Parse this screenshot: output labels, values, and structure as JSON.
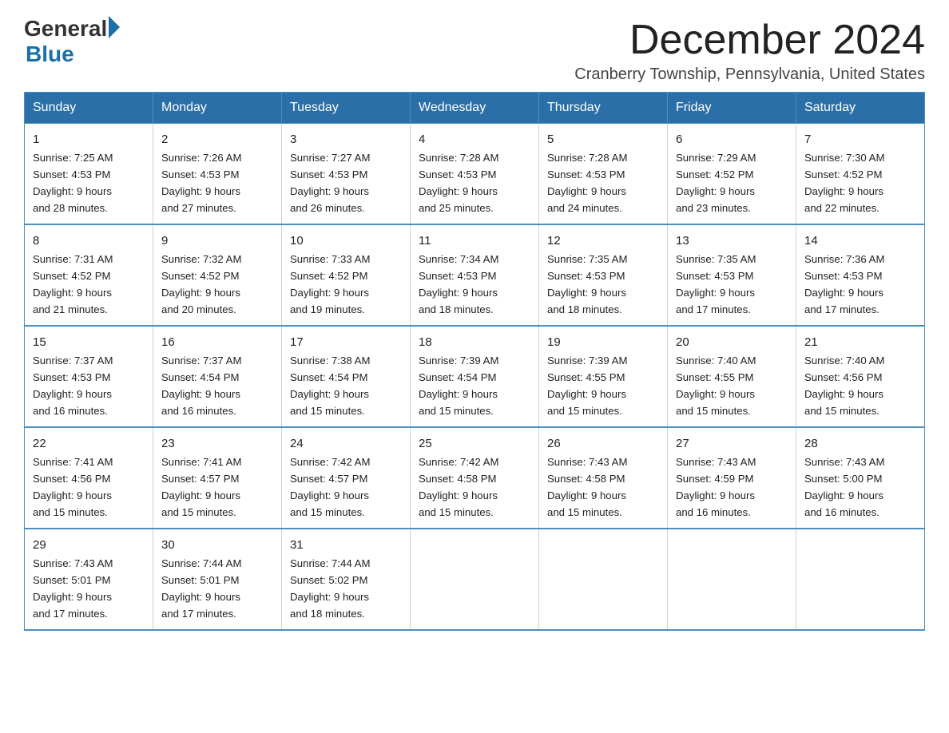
{
  "header": {
    "logo_general": "General",
    "logo_blue": "Blue",
    "month_title": "December 2024",
    "location": "Cranberry Township, Pennsylvania, United States"
  },
  "weekdays": [
    "Sunday",
    "Monday",
    "Tuesday",
    "Wednesday",
    "Thursday",
    "Friday",
    "Saturday"
  ],
  "weeks": [
    [
      {
        "day": "1",
        "sunrise": "7:25 AM",
        "sunset": "4:53 PM",
        "daylight": "9 hours and 28 minutes."
      },
      {
        "day": "2",
        "sunrise": "7:26 AM",
        "sunset": "4:53 PM",
        "daylight": "9 hours and 27 minutes."
      },
      {
        "day": "3",
        "sunrise": "7:27 AM",
        "sunset": "4:53 PM",
        "daylight": "9 hours and 26 minutes."
      },
      {
        "day": "4",
        "sunrise": "7:28 AM",
        "sunset": "4:53 PM",
        "daylight": "9 hours and 25 minutes."
      },
      {
        "day": "5",
        "sunrise": "7:28 AM",
        "sunset": "4:53 PM",
        "daylight": "9 hours and 24 minutes."
      },
      {
        "day": "6",
        "sunrise": "7:29 AM",
        "sunset": "4:52 PM",
        "daylight": "9 hours and 23 minutes."
      },
      {
        "day": "7",
        "sunrise": "7:30 AM",
        "sunset": "4:52 PM",
        "daylight": "9 hours and 22 minutes."
      }
    ],
    [
      {
        "day": "8",
        "sunrise": "7:31 AM",
        "sunset": "4:52 PM",
        "daylight": "9 hours and 21 minutes."
      },
      {
        "day": "9",
        "sunrise": "7:32 AM",
        "sunset": "4:52 PM",
        "daylight": "9 hours and 20 minutes."
      },
      {
        "day": "10",
        "sunrise": "7:33 AM",
        "sunset": "4:52 PM",
        "daylight": "9 hours and 19 minutes."
      },
      {
        "day": "11",
        "sunrise": "7:34 AM",
        "sunset": "4:53 PM",
        "daylight": "9 hours and 18 minutes."
      },
      {
        "day": "12",
        "sunrise": "7:35 AM",
        "sunset": "4:53 PM",
        "daylight": "9 hours and 18 minutes."
      },
      {
        "day": "13",
        "sunrise": "7:35 AM",
        "sunset": "4:53 PM",
        "daylight": "9 hours and 17 minutes."
      },
      {
        "day": "14",
        "sunrise": "7:36 AM",
        "sunset": "4:53 PM",
        "daylight": "9 hours and 17 minutes."
      }
    ],
    [
      {
        "day": "15",
        "sunrise": "7:37 AM",
        "sunset": "4:53 PM",
        "daylight": "9 hours and 16 minutes."
      },
      {
        "day": "16",
        "sunrise": "7:37 AM",
        "sunset": "4:54 PM",
        "daylight": "9 hours and 16 minutes."
      },
      {
        "day": "17",
        "sunrise": "7:38 AM",
        "sunset": "4:54 PM",
        "daylight": "9 hours and 15 minutes."
      },
      {
        "day": "18",
        "sunrise": "7:39 AM",
        "sunset": "4:54 PM",
        "daylight": "9 hours and 15 minutes."
      },
      {
        "day": "19",
        "sunrise": "7:39 AM",
        "sunset": "4:55 PM",
        "daylight": "9 hours and 15 minutes."
      },
      {
        "day": "20",
        "sunrise": "7:40 AM",
        "sunset": "4:55 PM",
        "daylight": "9 hours and 15 minutes."
      },
      {
        "day": "21",
        "sunrise": "7:40 AM",
        "sunset": "4:56 PM",
        "daylight": "9 hours and 15 minutes."
      }
    ],
    [
      {
        "day": "22",
        "sunrise": "7:41 AM",
        "sunset": "4:56 PM",
        "daylight": "9 hours and 15 minutes."
      },
      {
        "day": "23",
        "sunrise": "7:41 AM",
        "sunset": "4:57 PM",
        "daylight": "9 hours and 15 minutes."
      },
      {
        "day": "24",
        "sunrise": "7:42 AM",
        "sunset": "4:57 PM",
        "daylight": "9 hours and 15 minutes."
      },
      {
        "day": "25",
        "sunrise": "7:42 AM",
        "sunset": "4:58 PM",
        "daylight": "9 hours and 15 minutes."
      },
      {
        "day": "26",
        "sunrise": "7:43 AM",
        "sunset": "4:58 PM",
        "daylight": "9 hours and 15 minutes."
      },
      {
        "day": "27",
        "sunrise": "7:43 AM",
        "sunset": "4:59 PM",
        "daylight": "9 hours and 16 minutes."
      },
      {
        "day": "28",
        "sunrise": "7:43 AM",
        "sunset": "5:00 PM",
        "daylight": "9 hours and 16 minutes."
      }
    ],
    [
      {
        "day": "29",
        "sunrise": "7:43 AM",
        "sunset": "5:01 PM",
        "daylight": "9 hours and 17 minutes."
      },
      {
        "day": "30",
        "sunrise": "7:44 AM",
        "sunset": "5:01 PM",
        "daylight": "9 hours and 17 minutes."
      },
      {
        "day": "31",
        "sunrise": "7:44 AM",
        "sunset": "5:02 PM",
        "daylight": "9 hours and 18 minutes."
      },
      {
        "day": "",
        "sunrise": "",
        "sunset": "",
        "daylight": ""
      },
      {
        "day": "",
        "sunrise": "",
        "sunset": "",
        "daylight": ""
      },
      {
        "day": "",
        "sunrise": "",
        "sunset": "",
        "daylight": ""
      },
      {
        "day": "",
        "sunrise": "",
        "sunset": "",
        "daylight": ""
      }
    ]
  ],
  "labels": {
    "sunrise": "Sunrise: ",
    "sunset": "Sunset: ",
    "daylight": "Daylight: "
  }
}
